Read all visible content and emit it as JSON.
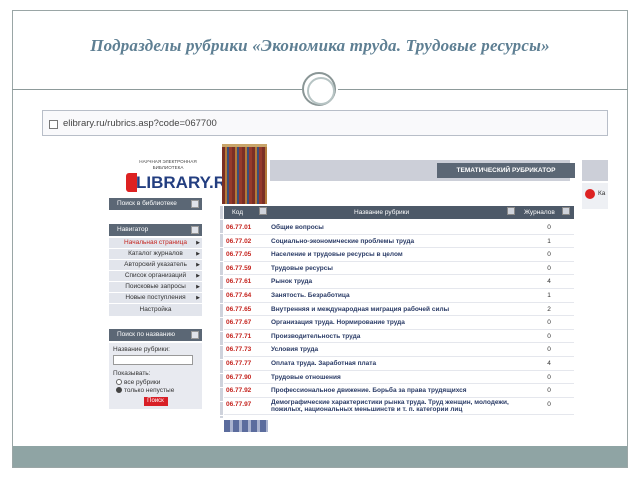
{
  "slide": {
    "title": "Подразделы рубрики «Экономика труда. Трудовые ресурсы»"
  },
  "browser": {
    "url": "elibrary.ru/rubrics.asp?code=067700"
  },
  "site": {
    "logo_small_line1": "НАУЧНАЯ ЭЛЕКТРОННАЯ",
    "logo_small_line2": "БИБЛИОТЕКА",
    "logo_big": "LIBRARY.RU",
    "rubricator_header": "ТЕМАТИЧЕСКИЙ РУБРИКАТОР",
    "right_cut_text": "Ка"
  },
  "sidebar": {
    "search_library": "Поиск в библиотеке",
    "navigator_title": "Навигатор",
    "nav_items": [
      {
        "label": "Начальная страница",
        "active": true
      },
      {
        "label": "Каталог журналов",
        "active": false
      },
      {
        "label": "Авторский указатель",
        "active": false
      },
      {
        "label": "Список организаций",
        "active": false
      },
      {
        "label": "Поисковые запросы",
        "active": false
      },
      {
        "label": "Новые поступления",
        "active": false
      },
      {
        "label": "Настройка",
        "active": false
      }
    ],
    "search_by_name_title": "Поиск по названию",
    "rubric_name_label": "Название рубрики:",
    "rubric_name_value": "",
    "show_label": "Показывать:",
    "radio_all": "все рубрики",
    "radio_nonempty": "только непустые",
    "find_button": "Поиск"
  },
  "table": {
    "col_code": "Код",
    "col_name": "Название рубрики",
    "col_journals": "Журналов",
    "rows": [
      {
        "code": "06.77.01",
        "name": "Общие вопросы",
        "count": "0"
      },
      {
        "code": "06.77.02",
        "name": "Социально-экономические проблемы труда",
        "count": "1"
      },
      {
        "code": "06.77.05",
        "name": "Население и трудовые ресурсы в целом",
        "count": "0"
      },
      {
        "code": "06.77.59",
        "name": "Трудовые ресурсы",
        "count": "0"
      },
      {
        "code": "06.77.61",
        "name": "Рынок труда",
        "count": "4"
      },
      {
        "code": "06.77.64",
        "name": "Занятость. Безработица",
        "count": "1"
      },
      {
        "code": "06.77.65",
        "name": "Внутренняя и международная миграция рабочей силы",
        "count": "2"
      },
      {
        "code": "06.77.67",
        "name": "Организация труда. Нормирование труда",
        "count": "0"
      },
      {
        "code": "06.77.71",
        "name": "Производительность труда",
        "count": "0"
      },
      {
        "code": "06.77.73",
        "name": "Условия труда",
        "count": "0"
      },
      {
        "code": "06.77.77",
        "name": "Оплата труда. Заработная плата",
        "count": "4"
      },
      {
        "code": "06.77.90",
        "name": "Трудовые отношения",
        "count": "0"
      },
      {
        "code": "06.77.92",
        "name": "Профессиональное движение. Борьба за права трудящихся",
        "count": "0"
      },
      {
        "code": "06.77.97",
        "name": "Демографические характеристики рынка труда. Труд женщин, молодежи, пожилых, национальных меньшинств и т. п. категории лиц",
        "count": "0"
      }
    ]
  }
}
